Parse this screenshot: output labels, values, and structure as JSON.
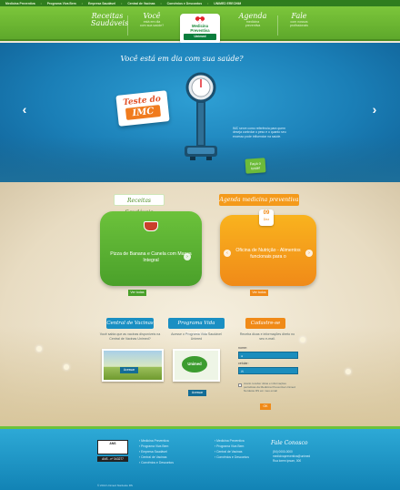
{
  "topbar": {
    "links": [
      "Medicina Preventiva",
      "Programa Viva Bem",
      "Empresa Saudável",
      "Central de Vacinas",
      "Convênios e Descontos"
    ],
    "extra": "UNIMED ERECHIM"
  },
  "nav": {
    "receitas_big": "Receitas",
    "receitas_small": "Saudáveis",
    "voce_big": "Você",
    "voce_small1": "está em dia",
    "voce_small2": "com sua saúde?",
    "agenda_big": "Agenda",
    "agenda_small1": "medicina",
    "agenda_small2": "preventiva",
    "fale_big": "Fale",
    "fale_small1": "com nossos",
    "fale_small2": "profissionais",
    "logo_name1": "Medicina",
    "logo_name2": "Preventiva",
    "logo_bar": "Unimed"
  },
  "hero": {
    "headline": "Você está em dia com sua saúde?",
    "badge_line1": "Teste do",
    "badge_line2": "IMC",
    "text": "IMC serve como referência para quem deseja controlar o peso e o quanto seu excesso pode influenciar na saúde.",
    "cta": "Faça o teste!",
    "prev_icon": "‹",
    "next_icon": "›"
  },
  "receitas": {
    "title": "Receitas Saudáveis",
    "card_text": "Pizza de Banana e Canela com Massa Integral",
    "ver_todos": "Ver todas",
    "arrow": "›"
  },
  "agenda": {
    "title": "Agenda medicina preventiva",
    "day": "09",
    "month": "Dez",
    "card_text": "Oficina de Nutrição - Alimentos funcionais para o",
    "ver_todos": "Ver todos",
    "arrow_left": "‹",
    "arrow_right": "›"
  },
  "vacinas": {
    "title": "Central de Vacinas",
    "text": "Você sabia que as vacinas disponíveis na Central de Vacinas Unimed?",
    "acessar": "Acessar"
  },
  "viva": {
    "title": "Programa Vida Saudável",
    "text": "Acesse o Programa Vida Saudável Unimed",
    "badge": "Unimed",
    "acessar": "Acessar"
  },
  "cadastro": {
    "title": "Cadastre-se",
    "text": "Receba dicas e informações direto no seu e-mail.",
    "nome_label": "nome:",
    "email_label": "celular:",
    "checkbox_text": "Aceito receber dicas e informações periódicas da Medicina Preventiva Unimed Nordeste RS em meu email",
    "ok": "OK"
  },
  "footer": {
    "ans_1": "ANS",
    "ans_2": "ANS - nº 343277",
    "col1": [
      "Medicina Preventiva",
      "Programa Viva Bem",
      "Empresa Saudável",
      "Central de Vacinas",
      "Convênios e Descontos"
    ],
    "col2": [
      "Medicina Preventiva",
      "Programa Viva Bem",
      "Central de Vacinas",
      "Convênios e Descontos"
    ],
    "contact_title": "Fale Conosco",
    "contact_lines": [
      "(54) 0000-0000",
      "medicinapreventiva@unimed",
      "Rua lorem ipsum, 000"
    ],
    "copyright": "© 2014 Unimed Nordeste RS"
  },
  "colors": {
    "green": "#6cbb3a",
    "blue": "#1a7eb6",
    "orange": "#f49a1b"
  }
}
